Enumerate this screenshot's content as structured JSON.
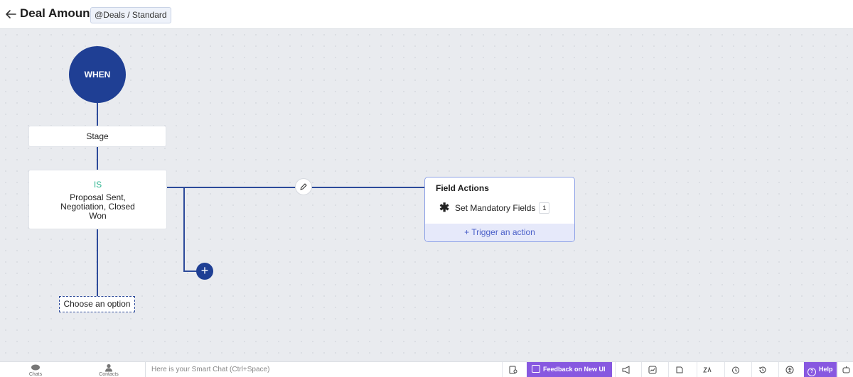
{
  "header": {
    "title": "Deal Amount",
    "badge": "@Deals / Standard"
  },
  "flow": {
    "when_label": "WHEN",
    "field": "Stage",
    "operator": "IS",
    "value": "Proposal Sent, Negotiation, Closed Won",
    "choose_option": "Choose an option",
    "add_symbol": "+"
  },
  "field_actions": {
    "title": "Field Actions",
    "item_label": "Set Mandatory Fields",
    "item_count": "1",
    "trigger_label": "+ Trigger an action"
  },
  "footer": {
    "chats_label": "Chats",
    "contacts_label": "Contacts",
    "chat_placeholder": "Here is your Smart Chat (Ctrl+Space)",
    "feedback_label": "Feedback on New UI",
    "help_label": "Help",
    "accent_color": "#8758e0"
  },
  "colors": {
    "primary": "#1f3f94",
    "operator": "#2bb38e",
    "trigger_text": "#4a5fc8"
  }
}
